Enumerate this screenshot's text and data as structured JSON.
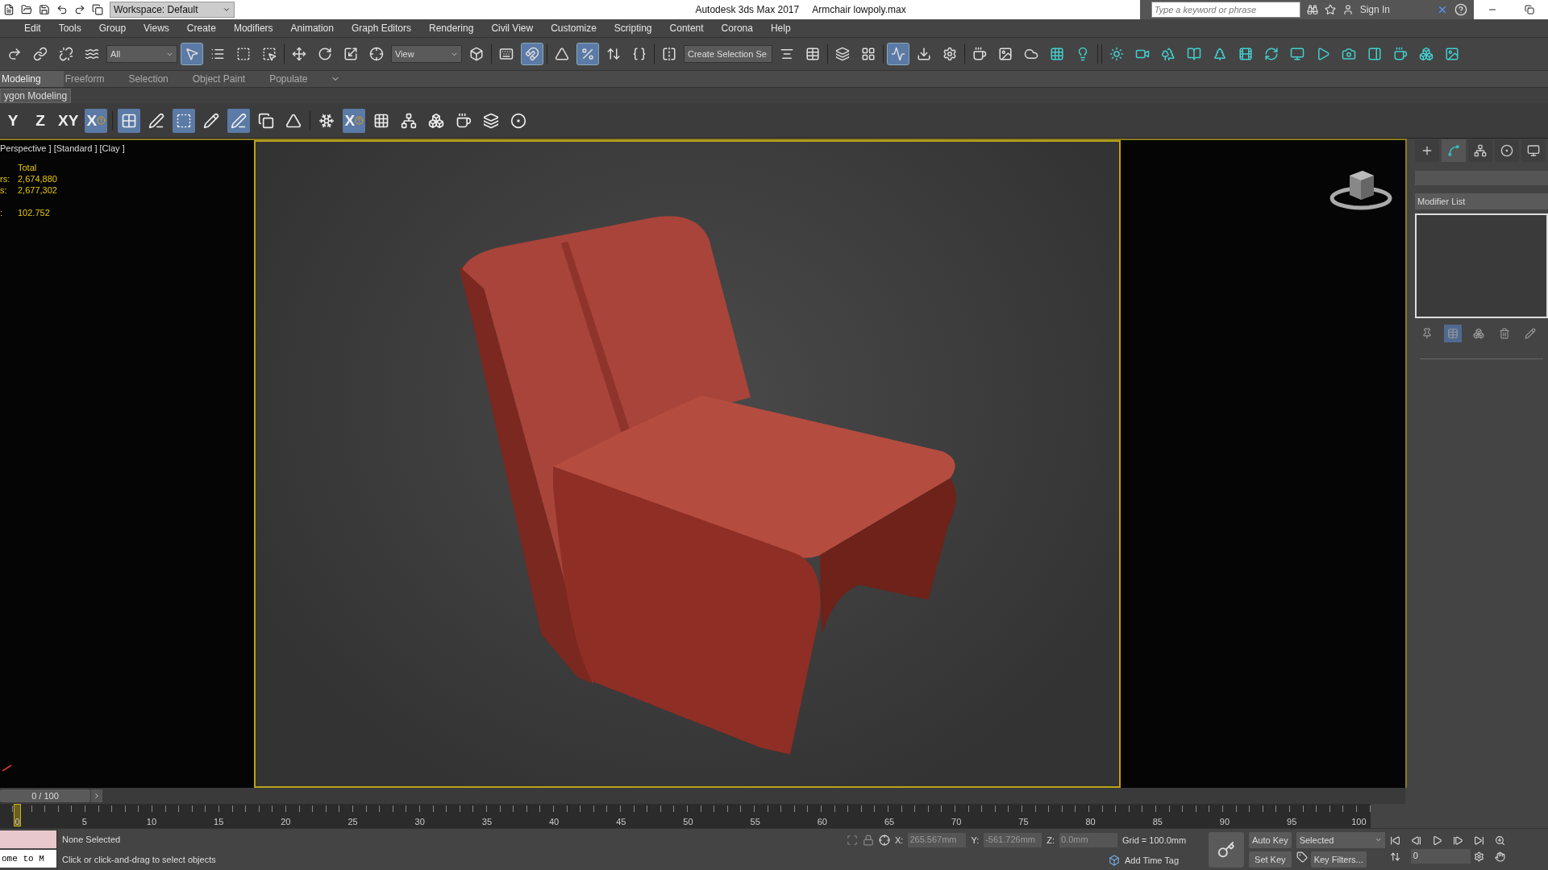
{
  "title_bar": {
    "workspace": "Workspace: Default",
    "app": "Autodesk 3ds Max 2017",
    "file": "Armchair lowpoly.max",
    "search": {
      "placeholder": "Type a keyword or phrase"
    },
    "sign_in": "Sign In"
  },
  "menu": [
    "Edit",
    "Tools",
    "Group",
    "Views",
    "Create",
    "Modifiers",
    "Animation",
    "Graph Editors",
    "Rendering",
    "Civil View",
    "Customize",
    "Scripting",
    "Content",
    "Corona",
    "Help"
  ],
  "main_toolbar": [
    {
      "kind": "button",
      "selected": false
    },
    {
      "kind": "button",
      "selected": false
    },
    {
      "kind": "button",
      "selected": false
    },
    {
      "kind": "button",
      "selected": false
    },
    {
      "kind": "dropdown",
      "text": "All"
    },
    {
      "kind": "button",
      "selected": true
    },
    {
      "kind": "button",
      "selected": false
    },
    {
      "kind": "button",
      "selected": false
    },
    {
      "kind": "button",
      "selected": false
    },
    {
      "kind": "separator"
    },
    {
      "kind": "button",
      "selected": false
    },
    {
      "kind": "button",
      "selected": false
    },
    {
      "kind": "button",
      "selected": false
    },
    {
      "kind": "button",
      "selected": false
    },
    {
      "kind": "dropdown",
      "text": "View"
    },
    {
      "kind": "button",
      "selected": false
    },
    {
      "kind": "separator"
    },
    {
      "kind": "button",
      "selected": false
    },
    {
      "kind": "button",
      "selected": true
    },
    {
      "kind": "separator"
    },
    {
      "kind": "button",
      "selected": false
    },
    {
      "kind": "button",
      "selected": true
    },
    {
      "kind": "button",
      "selected": false
    },
    {
      "kind": "button",
      "selected": false
    },
    {
      "kind": "separator"
    },
    {
      "kind": "button",
      "selected": false
    },
    {
      "kind": "dropdown",
      "text": "Create Selection Se"
    },
    {
      "kind": "button",
      "selected": false
    },
    {
      "kind": "button",
      "selected": false
    },
    {
      "kind": "separator"
    },
    {
      "kind": "button",
      "selected": false
    },
    {
      "kind": "button",
      "selected": false
    },
    {
      "kind": "separator"
    },
    {
      "kind": "button",
      "selected": true
    },
    {
      "kind": "button",
      "selected": false
    },
    {
      "kind": "button",
      "selected": false
    },
    {
      "kind": "separator"
    },
    {
      "kind": "button",
      "selected": false
    },
    {
      "kind": "button",
      "selected": false
    },
    {
      "kind": "button",
      "selected": false
    },
    {
      "kind": "button",
      "selected": false
    },
    {
      "kind": "button",
      "selected": false
    },
    {
      "kind": "separator"
    },
    {
      "kind": "separator"
    },
    {
      "kind": "button",
      "selected": false
    },
    {
      "kind": "button",
      "selected": false
    },
    {
      "kind": "button",
      "selected": false
    },
    {
      "kind": "button",
      "selected": false
    },
    {
      "kind": "button",
      "selected": false
    },
    {
      "kind": "button",
      "selected": false
    },
    {
      "kind": "button",
      "selected": false
    },
    {
      "kind": "button",
      "selected": false
    },
    {
      "kind": "button",
      "selected": false
    },
    {
      "kind": "button",
      "selected": false
    },
    {
      "kind": "button",
      "selected": false
    },
    {
      "kind": "button",
      "selected": false
    },
    {
      "kind": "button",
      "selected": false
    },
    {
      "kind": "button",
      "selected": false
    }
  ],
  "ribbon_tabs": [
    {
      "label": "Modeling",
      "selected": true
    },
    {
      "label": "Freeform",
      "selected": false
    },
    {
      "label": "Selection",
      "selected": false
    },
    {
      "label": "Object Paint",
      "selected": false
    },
    {
      "label": "Populate",
      "selected": false
    }
  ],
  "ribbon_panel": "ygon Modeling",
  "ribbon_tools": [
    {
      "kind": "text",
      "label": "Y",
      "selected": false
    },
    {
      "kind": "text",
      "label": "Z",
      "selected": false
    },
    {
      "kind": "text",
      "label": "XY",
      "selected": false
    },
    {
      "kind": "text",
      "label": "X",
      "selected": true
    },
    {
      "kind": "separator"
    },
    {
      "kind": "icon",
      "selected": true
    },
    {
      "kind": "icon",
      "selected": false
    },
    {
      "kind": "icon",
      "selected": true
    },
    {
      "kind": "icon",
      "selected": false
    },
    {
      "kind": "icon",
      "selected": true
    },
    {
      "kind": "icon",
      "selected": false
    },
    {
      "kind": "icon",
      "selected": false
    },
    {
      "kind": "separator"
    },
    {
      "kind": "icon",
      "selected": false
    },
    {
      "kind": "text",
      "label": "X",
      "selected": true
    },
    {
      "kind": "icon",
      "selected": false
    },
    {
      "kind": "icon",
      "selected": false
    },
    {
      "kind": "icon",
      "selected": false
    },
    {
      "kind": "icon",
      "selected": false
    },
    {
      "kind": "icon",
      "selected": false
    },
    {
      "kind": "icon",
      "selected": false
    }
  ],
  "viewport": {
    "label": "Perspective ] [Standard ] [Clay ]",
    "stats_header": "Total",
    "stats": [
      {
        "label": "rs:",
        "value": "2,674,880"
      },
      {
        "label": "s:",
        "value": "2,677,302"
      },
      {
        "label": ":",
        "value": "102.752"
      }
    ]
  },
  "command_panel": {
    "tabs": [
      {
        "selected": false
      },
      {
        "selected": true
      },
      {
        "selected": false
      },
      {
        "selected": false
      },
      {
        "selected": false
      }
    ],
    "modifier_list": "Modifier List",
    "stack_tools": [
      {
        "selected": false
      },
      {
        "selected": true
      },
      {
        "selected": false
      },
      {
        "selected": false
      },
      {
        "selected": false
      }
    ]
  },
  "timeline": {
    "frame_slider": "0 / 100",
    "level": 0,
    "ruler_labels": [
      "0",
      "5",
      "10",
      "15",
      "20",
      "25",
      "30",
      "35",
      "40",
      "45",
      "50",
      "55",
      "60",
      "65",
      "70",
      "75",
      "80",
      "85",
      "90",
      "95",
      "100"
    ]
  },
  "status": {
    "listener": "ome to M",
    "selection": "None Selected",
    "prompt": "Click or click-and-drag to select objects",
    "x": "265.567mm",
    "y": "-561.726mm",
    "z": "0.0mm",
    "x_label": "X:",
    "y_label": "Y:",
    "z_label": "Z:",
    "grid": "Grid = 100.0mm",
    "time_tag": "Add Time Tag",
    "auto_key": "Auto Key",
    "key_mode": "Selected",
    "set_key": "Set Key",
    "key_filters": "Key Filters...",
    "frame": "0"
  }
}
